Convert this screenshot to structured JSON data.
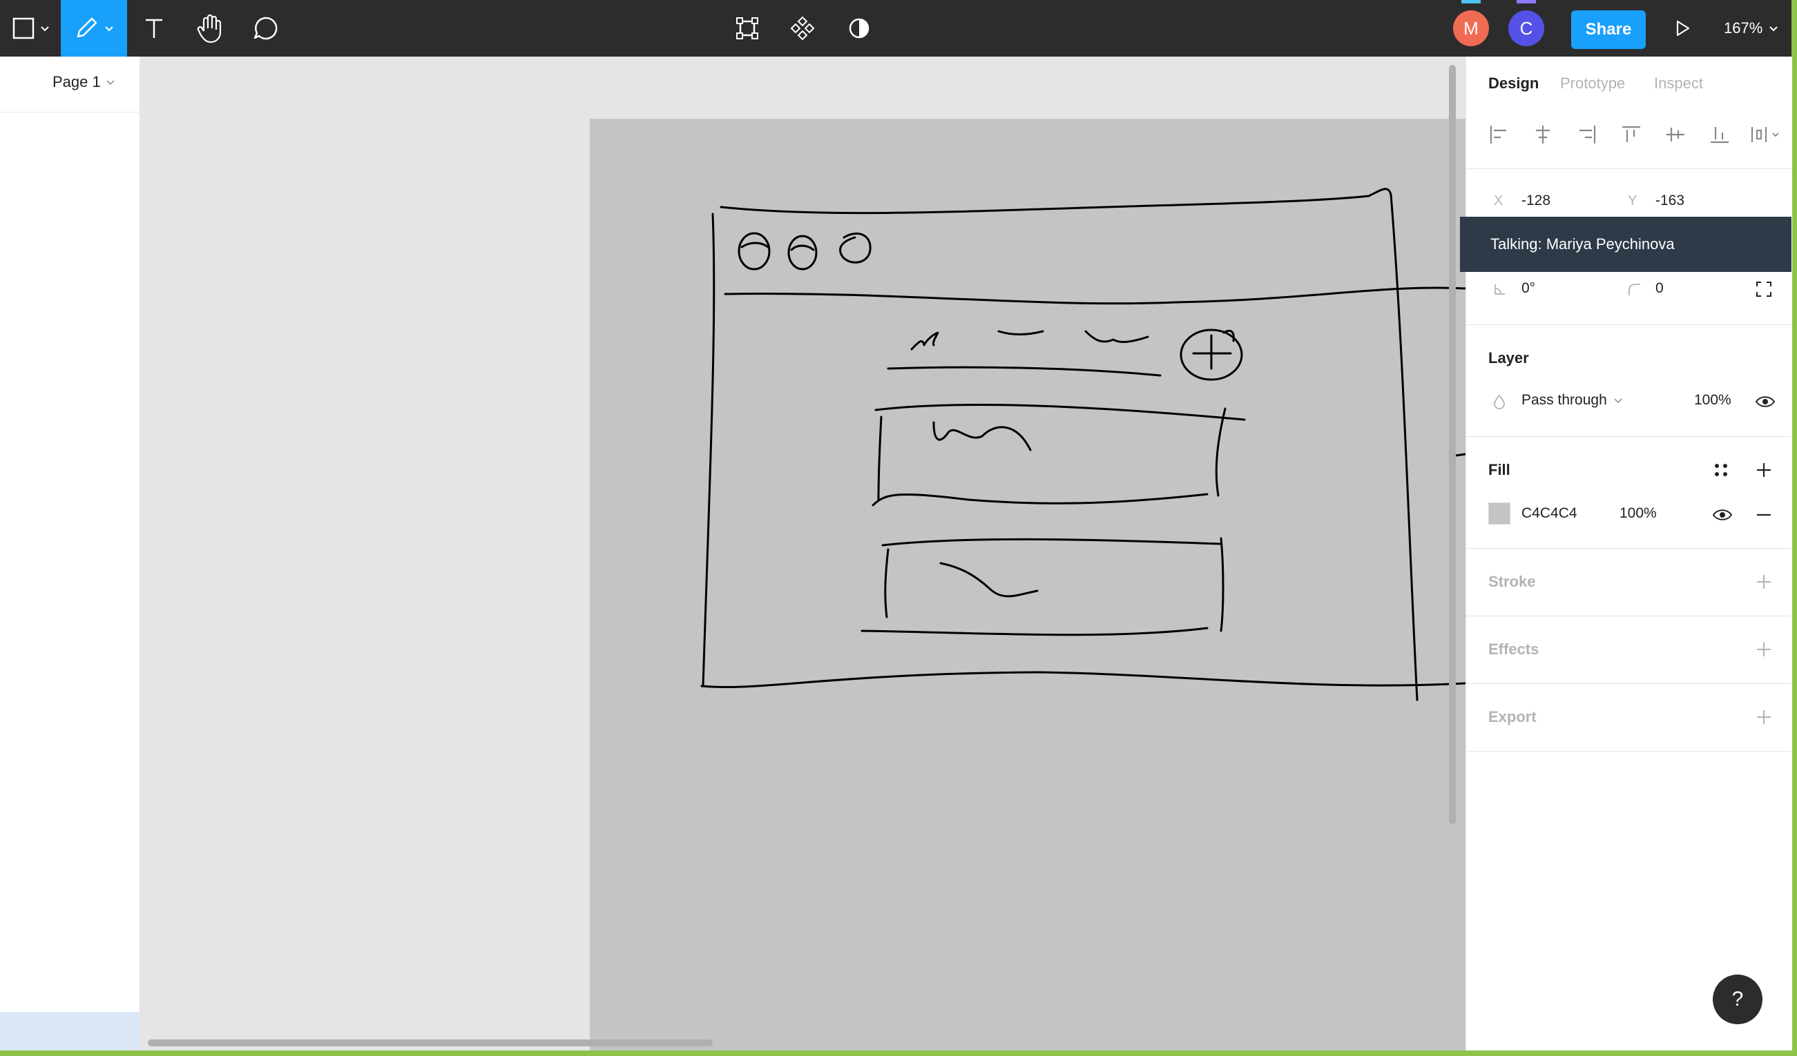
{
  "toolbar": {
    "share_label": "Share",
    "zoom": "167%",
    "avatars": [
      {
        "initial": "M",
        "color": "#f06b54"
      },
      {
        "initial": "C",
        "color": "#5551e6"
      }
    ],
    "accent_color": "#18a0fb"
  },
  "left_panel": {
    "page_name": "Page 1"
  },
  "right_panel": {
    "tabs": [
      "Design",
      "Prototype",
      "Inspect"
    ],
    "x_label": "X",
    "x_value": "-128",
    "y_label": "Y",
    "y_value": "-163",
    "rotation": "0°",
    "corner_radius": "0",
    "talking_banner": "Talking: Mariya Peychinova",
    "layer": {
      "title": "Layer",
      "blend_mode": "Pass through",
      "opacity": "100%"
    },
    "fill": {
      "title": "Fill",
      "color_hex": "C4C4C4",
      "opacity": "100%"
    },
    "stroke_title": "Stroke",
    "effects_title": "Effects",
    "export_title": "Export"
  },
  "help_label": "?"
}
